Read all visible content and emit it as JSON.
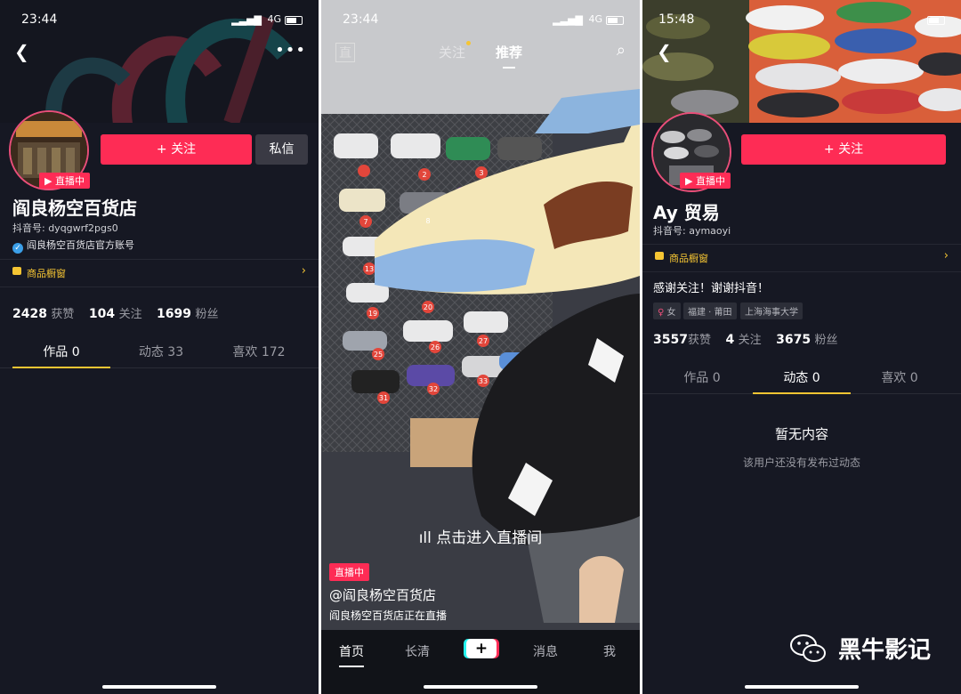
{
  "left": {
    "status": {
      "time": "23:44",
      "network": "4G"
    },
    "profile_name": "阎良杨空百货店",
    "douyin_id": "抖音号: dyqgwrf2pgs0",
    "verified_label": "阎良杨空百货店官方账号",
    "live_badge": "▶ 直播中",
    "follow_label": "+ 关注",
    "message_label": "私信",
    "shop_label": "商品橱窗",
    "stats": {
      "likes": "2428",
      "likes_unit": "获赞",
      "following": "104",
      "following_unit": "关注",
      "fans": "1699",
      "fans_unit": "粉丝"
    },
    "tabs": [
      "作品 0",
      "动态 33",
      "喜欢 172"
    ]
  },
  "middle": {
    "status": {
      "time": "23:44",
      "network": "4G"
    },
    "top_nav": {
      "follow": "关注",
      "recommend": "推荐"
    },
    "enter_live": "点击进入直播间",
    "live_badge": "直播中",
    "author": "@阎良杨空百货店",
    "caption": "阎良杨空百货店正在直播",
    "bottom_nav": {
      "home": "首页",
      "long": "长清",
      "plus": "+",
      "messages": "消息",
      "me": "我"
    },
    "shoe_numbers": [
      "2",
      "3",
      "7",
      "8",
      "13",
      "19",
      "20",
      "25",
      "26",
      "27",
      "31",
      "32",
      "33"
    ]
  },
  "right": {
    "status": {
      "time": "15:48"
    },
    "profile_name": "Ay 贸易",
    "douyin_id": "抖音号: aymaoyi",
    "live_badge": "▶ 直播中",
    "follow_label": "+ 关注",
    "shop_label": "商品橱窗",
    "bio": "感谢关注！谢谢抖音！",
    "tags": [
      "女",
      "福建 · 莆田",
      "上海海事大学"
    ],
    "stats": {
      "likes": "3557",
      "likes_unit": "获赞",
      "following": "4",
      "following_unit": "关注",
      "fans": "3675",
      "fans_unit": "粉丝"
    },
    "tabs": [
      "作品 0",
      "动态 0",
      "喜欢 0"
    ],
    "empty_title": "暂无内容",
    "empty_sub": "该用户还没有发布过动态"
  },
  "watermark": "黑牛影记",
  "colors": {
    "accent": "#fe2c55",
    "gold": "#f5c533",
    "bg": "#161823"
  }
}
